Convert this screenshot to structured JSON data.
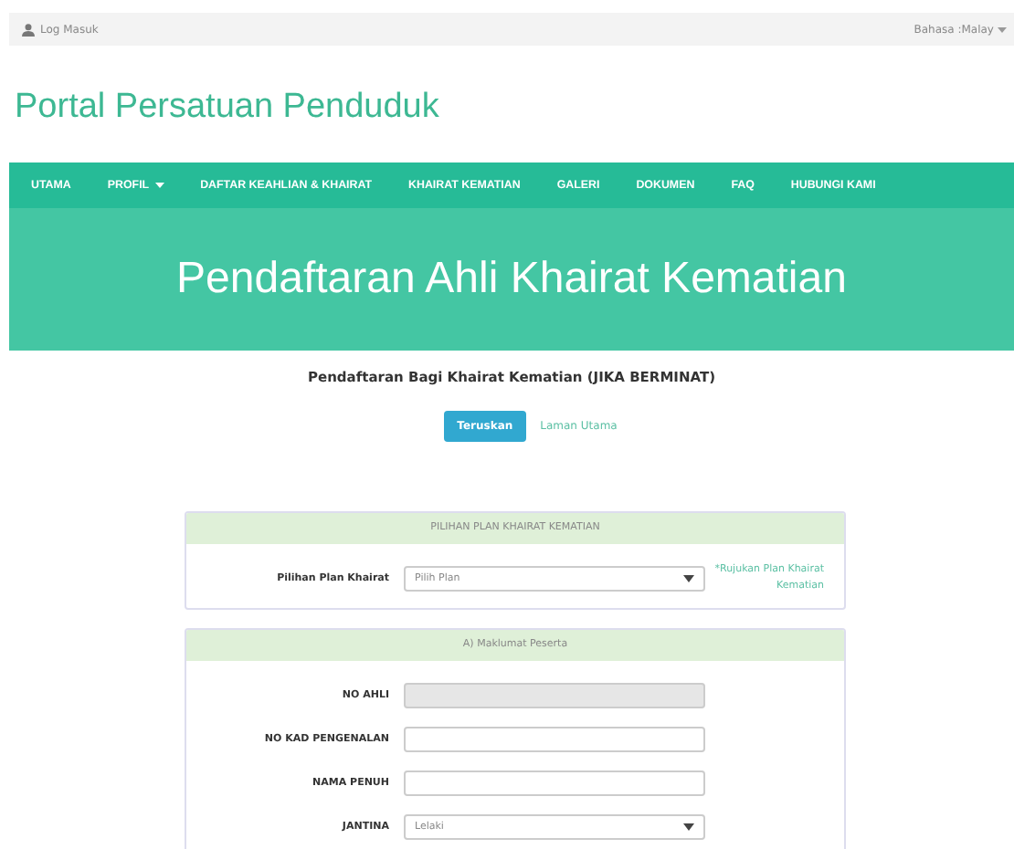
{
  "top_bar": {
    "login": "Log Masuk",
    "language": "Bahasa :Malay"
  },
  "site_title": "Portal Persatuan Penduduk",
  "nav": [
    {
      "label": "UTAMA",
      "dropdown": false
    },
    {
      "label": "PROFIL",
      "dropdown": true
    },
    {
      "label": "DAFTAR KEAHLIAN & KHAIRAT",
      "dropdown": false
    },
    {
      "label": "KHAIRAT KEMATIAN",
      "dropdown": false
    },
    {
      "label": "GALERI",
      "dropdown": false
    },
    {
      "label": "DOKUMEN",
      "dropdown": false
    },
    {
      "label": "FAQ",
      "dropdown": false
    },
    {
      "label": "HUBUNGI KAMI",
      "dropdown": false
    }
  ],
  "hero": "Pendaftaran Ahli Khairat Kematian",
  "intro": "Pendaftaran Bagi Khairat Kematian (JIKA BERMINAT)",
  "actions": {
    "primary": "Teruskan",
    "link": "Laman Utama"
  },
  "panels": [
    {
      "header": "PILIHAN PLAN KHAIRAT KEMATIAN",
      "note": "*Rujukan Plan Khairat Kematian",
      "fields": [
        {
          "label": "Pilihan Plan Khairat",
          "kind": "select",
          "value": "Pilih Plan",
          "disabled": false
        }
      ]
    },
    {
      "header": "A) Maklumat Peserta",
      "fields": [
        {
          "label": "NO AHLI",
          "kind": "text",
          "disabled": true
        },
        {
          "label": "NO KAD PENGENALAN",
          "kind": "text",
          "disabled": false
        },
        {
          "label": "NAMA PENUH",
          "kind": "text",
          "disabled": false
        },
        {
          "label": "JANTINA",
          "kind": "select",
          "value": "Lelaki",
          "disabled": false
        }
      ]
    }
  ]
}
